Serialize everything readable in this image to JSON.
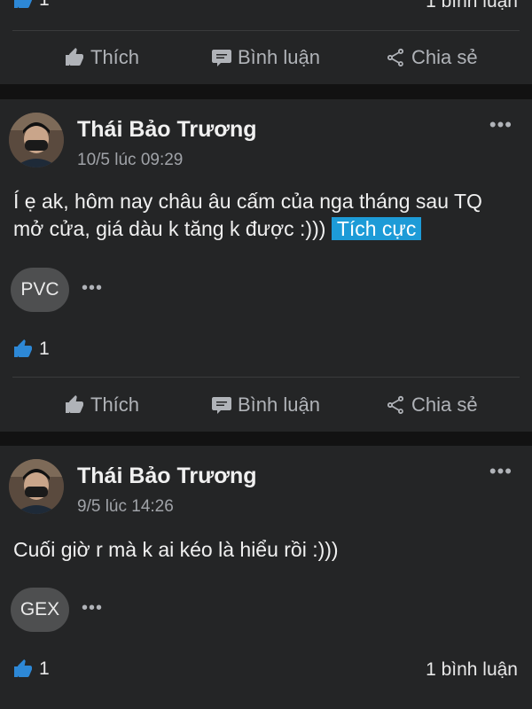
{
  "top_card": {
    "like_count": "1",
    "comment_count": "1 bình luận",
    "actions": {
      "like": "Thích",
      "comment": "Bình luận",
      "share": "Chia sẻ"
    }
  },
  "posts": [
    {
      "author": "Thái Bảo Trương",
      "time": "10/5 lúc 09:29",
      "more": "•••",
      "text": "Í ẹ ak, hôm nay châu âu cấm của nga tháng sau TQ mở cửa, giá dàu k tăng k được  :)))",
      "sentiment_tag": "Tích cực",
      "ticker": "PVC",
      "chip_more": "•••",
      "like_count": "1",
      "actions": {
        "like": "Thích",
        "comment": "Bình luận",
        "share": "Chia sẻ"
      }
    },
    {
      "author": "Thái Bảo Trương",
      "time": "9/5 lúc 14:26",
      "more": "•••",
      "text": "Cuối giờ r mà k ai kéo là hiểu rồi :)))",
      "ticker": "GEX",
      "chip_more": "•••",
      "like_count": "1",
      "comment_count": "1 bình luận"
    }
  ],
  "colors": {
    "background": "#121212",
    "card": "#242526",
    "accent_blue": "#1d9bd7",
    "like_blue": "#2d88d6"
  },
  "icons": [
    "thumbs-up-icon",
    "comment-icon",
    "share-icon",
    "more-icon"
  ]
}
